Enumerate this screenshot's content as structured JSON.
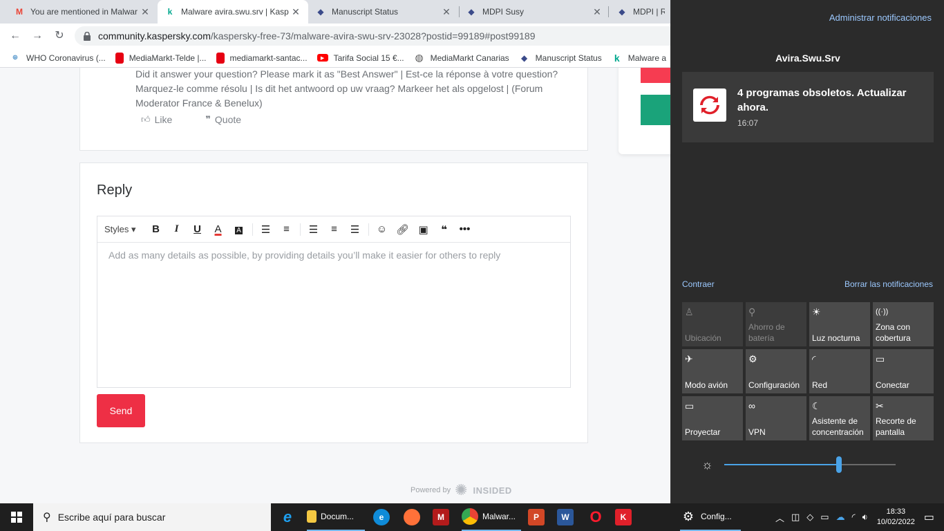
{
  "browser": {
    "tabs": [
      {
        "title": "You are mentioned in Malwar",
        "icon": "M",
        "color": "#ea4335"
      },
      {
        "title": "Malware avira.swu.srv | Kasp",
        "icon": "k",
        "color": "#00a88e"
      },
      {
        "title": "Manuscript Status",
        "icon": "◆",
        "color": "#3b4b8a"
      },
      {
        "title": "MDPI Susy",
        "icon": "◆",
        "color": "#3b4b8a"
      },
      {
        "title": "MDPI | Rep",
        "icon": "◆",
        "color": "#3b4b8a"
      }
    ],
    "url_host": "community.kaspersky.com",
    "url_path": "/kaspersky-free-73/malware-avira-swu-srv-23028?postid=99189#post99189",
    "bookmarks": [
      {
        "label": "WHO Coronavirus (...",
        "icon": "⊕",
        "color": "#4a90c8"
      },
      {
        "label": "MediaMarkt-Telde |...",
        "icon": "▮",
        "color": "#e60012"
      },
      {
        "label": "mediamarkt-santac...",
        "icon": "▮",
        "color": "#e60012"
      },
      {
        "label": "Tarifa Social 15 €...",
        "icon": "▶",
        "color": "#ff0000"
      },
      {
        "label": "MediaMarkt Canarias",
        "icon": "◍",
        "color": "#555"
      },
      {
        "label": "Manuscript Status",
        "icon": "◆",
        "color": "#3b4b8a"
      },
      {
        "label": "Malware a",
        "icon": "k",
        "color": "#00a88e"
      }
    ]
  },
  "post": {
    "signature": "Did it answer your question? Please mark it as \"Best Answer\" | Est-ce la réponse à votre question? Marquez-le comme résolu | Is dit het antwoord op uw vraag? Markeer het als opgelost | (Forum Moderator France & Benelux)",
    "like_label": "Like",
    "quote_label": "Quote"
  },
  "reply": {
    "title": "Reply",
    "styles_label": "Styles",
    "placeholder": "Add as many details as possible, by providing details you’ll make it easier for others to reply",
    "send_label": "Send"
  },
  "footer": {
    "powered_by": "Powered by",
    "brand": "INSIDED"
  },
  "action_center": {
    "manage": "Administrar notificaciones",
    "app_name": "Avira.Swu.Srv",
    "toast_message": "4 programas obsoletos. Actualizar ahora.",
    "toast_time": "16:07",
    "collapse": "Contraer",
    "clear": "Borrar las notificaciones",
    "quick_actions": [
      {
        "label": "Ubicación",
        "icon": "♙",
        "off": true
      },
      {
        "label": "Ahorro de batería",
        "icon": "⚲",
        "off": true
      },
      {
        "label": "Luz nocturna",
        "icon": "☀",
        "off": false
      },
      {
        "label": "Zona con cobertura",
        "icon": "((·))",
        "off": false
      },
      {
        "label": "Modo avión",
        "icon": "✈",
        "off": false
      },
      {
        "label": "Configuración",
        "icon": "⚙",
        "off": false
      },
      {
        "label": "Red",
        "icon": "◜",
        "off": false
      },
      {
        "label": "Conectar",
        "icon": "▭",
        "off": false
      },
      {
        "label": "Proyectar",
        "icon": "▭",
        "off": false
      },
      {
        "label": "VPN",
        "icon": "∞",
        "off": false
      },
      {
        "label": "Asistente de concentración",
        "icon": "☾",
        "off": false
      },
      {
        "label": "Recorte de pantalla",
        "icon": "✂",
        "off": false
      }
    ],
    "brightness_level": 0.67
  },
  "taskbar": {
    "search_placeholder": "Escribe aquí para buscar",
    "documents_label": "Docum...",
    "chrome_label": "Malwar...",
    "settings_label": "Config...",
    "time": "18:33",
    "date": "10/02/2022"
  }
}
